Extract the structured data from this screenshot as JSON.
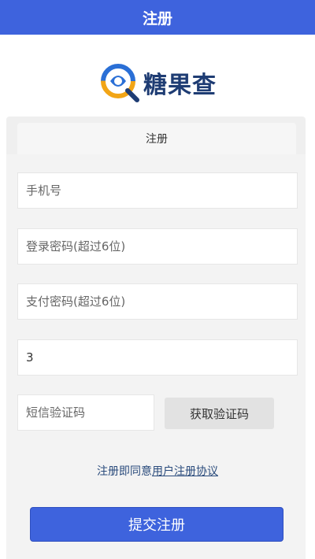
{
  "header": {
    "title": "注册"
  },
  "logo": {
    "text": "糖果查"
  },
  "tabs": [
    {
      "label": "注册"
    }
  ],
  "form": {
    "phone": {
      "placeholder": "手机号",
      "value": ""
    },
    "login_password": {
      "placeholder": "登录密码(超过6位)",
      "value": ""
    },
    "pay_password": {
      "placeholder": "支付密码(超过6位)",
      "value": ""
    },
    "invite_code": {
      "placeholder": "",
      "value": "3"
    },
    "sms_code": {
      "placeholder": "短信验证码",
      "value": ""
    },
    "sms_button_label": "获取验证码"
  },
  "agreement": {
    "prefix": "注册即同意",
    "link": "用户注册协议"
  },
  "submit_label": "提交注册",
  "colors": {
    "primary": "#3e63dd",
    "panel_bg": "#f3f3f3",
    "link": "#2a4b7c"
  }
}
